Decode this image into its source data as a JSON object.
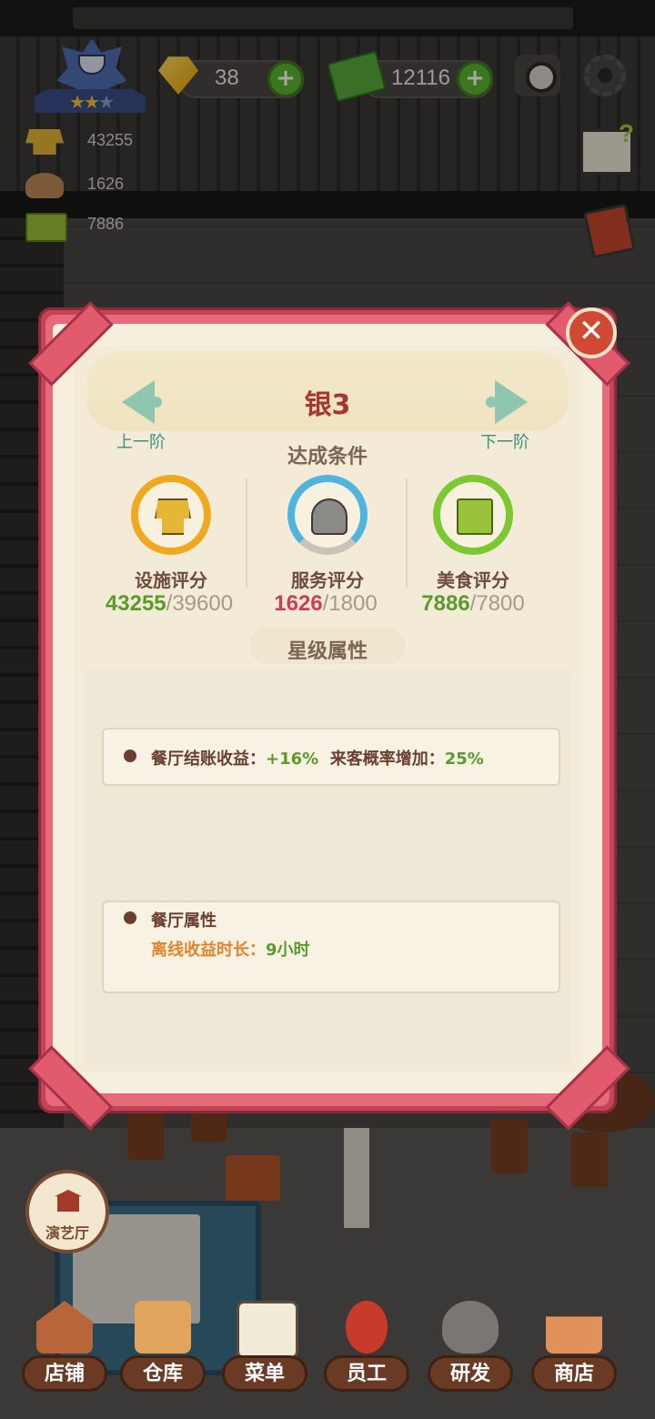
{
  "hud": {
    "gems": "38",
    "cash": "12116",
    "rank_stars_filled": 2,
    "rank_stars_total": 3,
    "stats": [
      {
        "icon": "facility-icon",
        "value": "43255"
      },
      {
        "icon": "service-icon",
        "value": "1626"
      },
      {
        "icon": "food-icon",
        "value": "7886"
      }
    ]
  },
  "dialog": {
    "title": "银3",
    "prev_label": "上一阶",
    "next_label": "下一阶",
    "conditions_title": "达成条件",
    "ratings": [
      {
        "name": "设施评分",
        "current": "43255",
        "target": "39600",
        "met": true,
        "progress": 1.0
      },
      {
        "name": "服务评分",
        "current": "1626",
        "target": "1800",
        "met": false,
        "progress": 0.9
      },
      {
        "name": "美食评分",
        "current": "7886",
        "target": "7800",
        "met": true,
        "progress": 1.0
      }
    ],
    "star_attr_title": "星级属性",
    "bonus": {
      "checkout_label": "餐厅结账收益：",
      "checkout_value": "+16%",
      "visit_label": "来客概率增加：",
      "visit_value": "25%"
    },
    "restaurant_attr": {
      "title": "餐厅属性",
      "offline_label": "离线收益时长：",
      "offline_value": "9小时"
    },
    "close_icon": "close-icon"
  },
  "side_button": {
    "label": "演艺厅"
  },
  "nav": [
    {
      "label": "店铺",
      "icon": "shop-icon"
    },
    {
      "label": "仓库",
      "icon": "warehouse-icon"
    },
    {
      "label": "菜单",
      "icon": "menu-icon"
    },
    {
      "label": "员工",
      "icon": "staff-icon"
    },
    {
      "label": "研发",
      "icon": "research-icon"
    },
    {
      "label": "商店",
      "icon": "store-icon"
    }
  ],
  "colors": {
    "frame": "#c24456",
    "met": "#5b9b2c",
    "unmet": "#cf3d4f",
    "title": "#a8352e"
  }
}
